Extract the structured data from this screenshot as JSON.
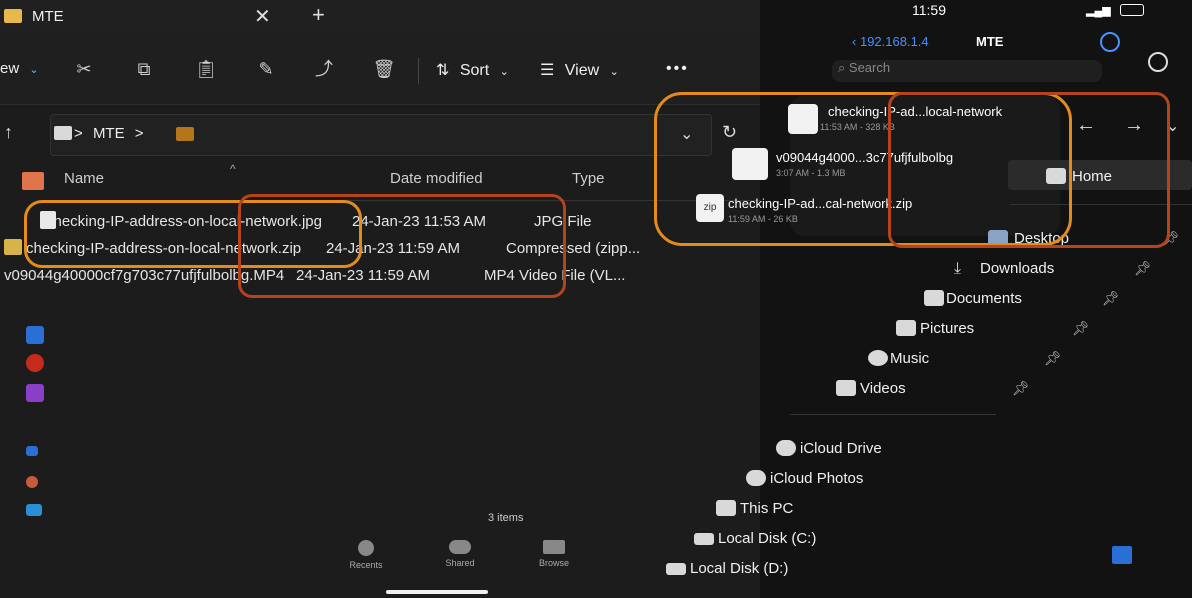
{
  "window": {
    "tab_title": "MTE"
  },
  "toolbar": {
    "new_label": "ew",
    "sort_label": "Sort",
    "view_label": "View",
    "more_label": "•••"
  },
  "address": {
    "path_folder": "MTE",
    "separator": ">"
  },
  "columns": {
    "name": "Name",
    "date": "Date modified",
    "type": "Type"
  },
  "files": [
    {
      "name": "checking-IP-address-on-local-network.jpg",
      "date": "24-Jan-23 11:53 AM",
      "type": "JPG File"
    },
    {
      "name": "checking-IP-address-on-local-network.zip",
      "date": "24-Jan-23 11:59 AM",
      "type": "Compressed (zipp..."
    },
    {
      "name": "v09044g40000cf7g703c77ufjfulbolbg.MP4",
      "date": "24-Jan-23 11:59 AM",
      "type": "MP4 Video File (VL..."
    }
  ],
  "status": {
    "items_count": "3 items"
  },
  "ios": {
    "time": "11:59",
    "back_label": "192.168.1.4",
    "folder_title": "MTE",
    "search_placeholder": "Search",
    "popup_files": [
      {
        "name": "checking-IP-ad...local-network",
        "meta": "11:53 AM - 328 KB"
      },
      {
        "name": "v09044g4000...3c77ufjfulbolbg",
        "meta": "3:07 AM - 1.3 MB"
      },
      {
        "name": "checking-IP-ad...cal-network.zip",
        "meta": "11:59 AM - 26 KB"
      }
    ],
    "zip_badge": "zip",
    "tabs": {
      "recents": "Recents",
      "shared": "Shared",
      "browse": "Browse"
    }
  },
  "nav": {
    "home": "Home",
    "desktop": "Desktop",
    "downloads": "Downloads",
    "documents": "Documents",
    "pictures": "Pictures",
    "music": "Music",
    "videos": "Videos",
    "icloud_drive": "iCloud Drive",
    "icloud_photos": "iCloud Photos",
    "this_pc": "This PC",
    "local_c": "Local Disk (C:)",
    "local_d": "Local Disk (D:)"
  },
  "colors": {
    "highlight": "#e58b1c",
    "background": "#1c1c1c"
  }
}
